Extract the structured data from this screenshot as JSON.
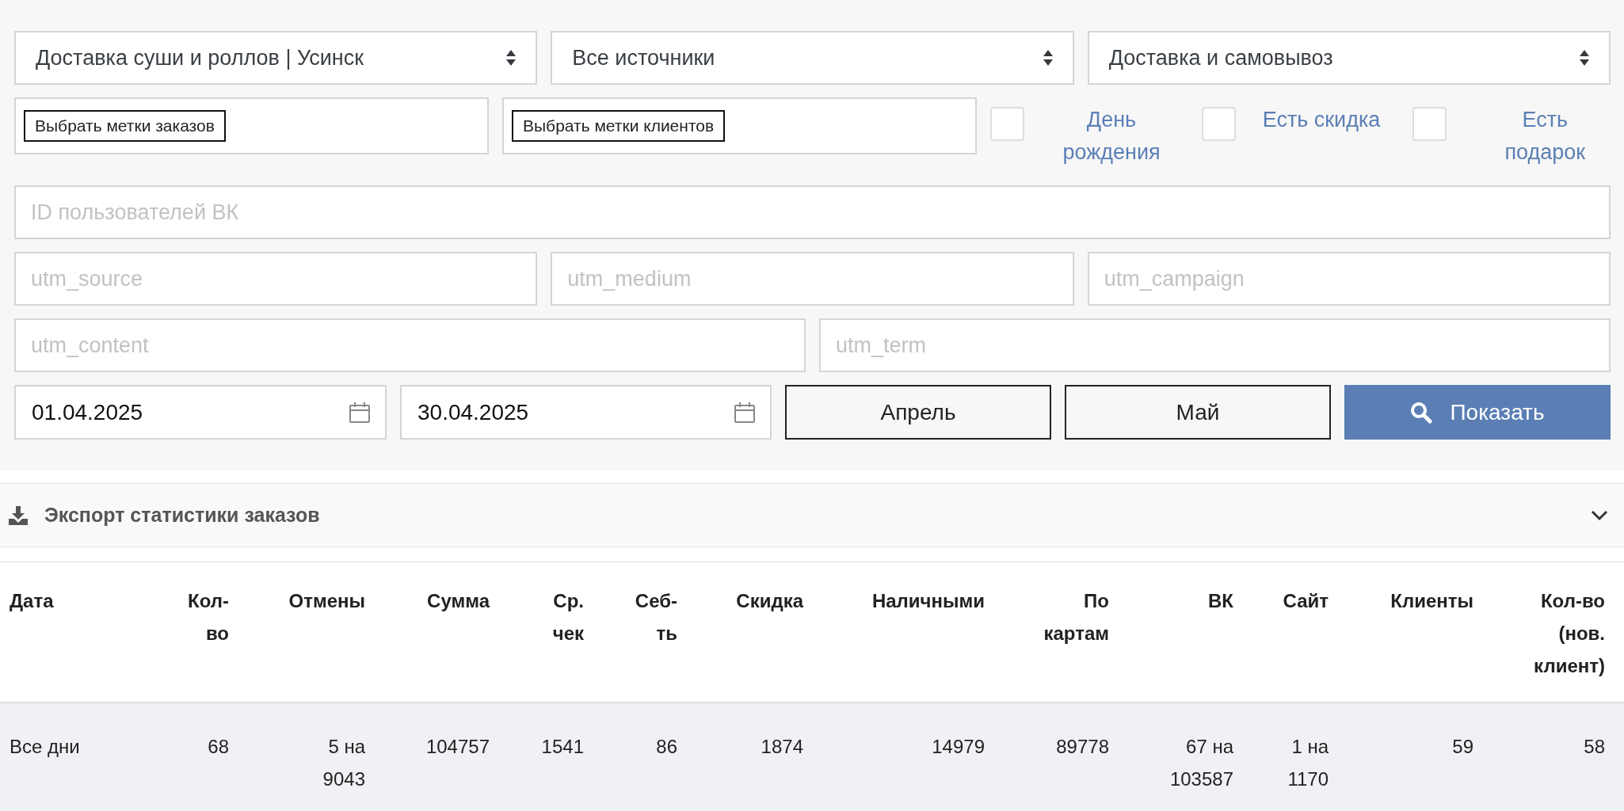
{
  "filters": {
    "selects": [
      {
        "value": "Доставка суши и роллов | Усинск"
      },
      {
        "value": "Все источники"
      },
      {
        "value": "Доставка и самовывоз"
      }
    ],
    "tag_pickers": [
      {
        "label": "Выбрать метки заказов"
      },
      {
        "label": "Выбрать метки клиентов"
      }
    ],
    "checkboxes": [
      {
        "label": "День рождения",
        "checked": false
      },
      {
        "label": "Есть скидка",
        "checked": false
      },
      {
        "label": "Есть подарок",
        "checked": false
      }
    ],
    "vk_ids": {
      "placeholder": "ID пользователей ВК"
    },
    "utm_fields": [
      {
        "placeholder": "utm_source"
      },
      {
        "placeholder": "utm_medium"
      },
      {
        "placeholder": "utm_campaign"
      },
      {
        "placeholder": "utm_content"
      },
      {
        "placeholder": "utm_term"
      }
    ],
    "date_from": {
      "value": "01.04.2025"
    },
    "date_to": {
      "value": "30.04.2025"
    },
    "buttons": [
      {
        "label": "Апрель",
        "kind": "outline"
      },
      {
        "label": "Май",
        "kind": "outline"
      },
      {
        "label": "Показать",
        "kind": "primary"
      }
    ]
  },
  "export": {
    "title": "Экспорт статистики заказов",
    "expanded": false
  },
  "table": {
    "columns": [
      "Дата",
      "Кол-во",
      "Отмены",
      "Сумма",
      "Ср. чек",
      "Себ-ть",
      "Скидка",
      "Наличными",
      "По картам",
      "ВК",
      "Сайт",
      "Клиенты",
      "Кол-во (нов. клиент)"
    ],
    "rows": [
      {
        "cells": [
          "Все дни",
          "68",
          "5 на 9043",
          "104757",
          "1541",
          "86",
          "1874",
          "14979",
          "89778",
          "67 на 103587",
          "1 на 1170",
          "59",
          "58"
        ]
      }
    ]
  }
}
